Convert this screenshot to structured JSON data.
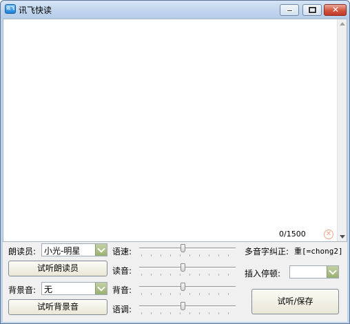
{
  "window": {
    "title": "讯飞快读",
    "icon_label": "讯飞"
  },
  "editor": {
    "text": "",
    "counter": "0/1500"
  },
  "voice": {
    "label": "朗读员:",
    "selected": "小光-明星",
    "preview_button": "试听朗读员"
  },
  "background": {
    "label": "背景音:",
    "selected": "无",
    "preview_button": "试听背景音"
  },
  "sliders": {
    "speed_label": "语速:",
    "speed_value": 0.45,
    "volume_label": "读音:",
    "volume_value": 0.45,
    "bg_volume_label": "背音:",
    "bg_volume_value": 0.45,
    "pitch_label": "语调:",
    "pitch_value": 0.45
  },
  "polyphone": {
    "label": "多音字纠正:",
    "example": "重[=chong2]"
  },
  "pause": {
    "label": "插入停顿:",
    "selected": ""
  },
  "actions": {
    "save_button": "试听/保存"
  },
  "colors": {
    "title_bar": "#c3d7ee",
    "close_button": "#d1553c",
    "combo_dropdown": "#98b070"
  }
}
